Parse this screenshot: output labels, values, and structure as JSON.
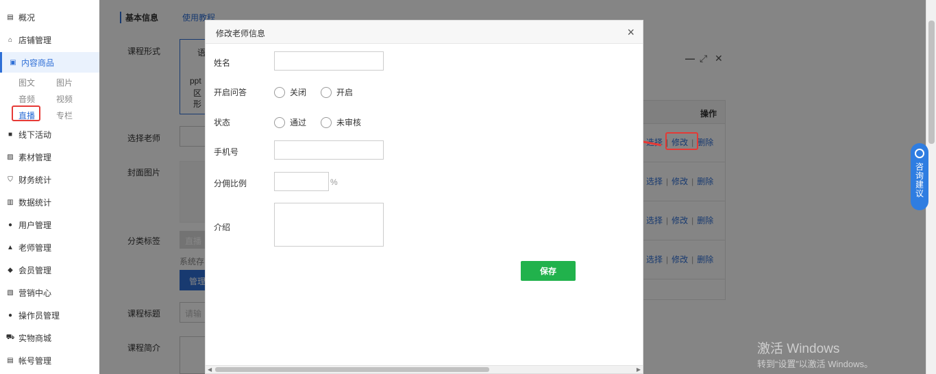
{
  "sidebar": {
    "items": [
      {
        "label": "概况",
        "icon": "dashboard-icon"
      },
      {
        "label": "店铺管理",
        "icon": "store-icon"
      },
      {
        "label": "内容商品",
        "icon": "bag-icon"
      },
      {
        "label": "线下活动",
        "icon": "flag-icon"
      },
      {
        "label": "素材管理",
        "icon": "image-icon"
      },
      {
        "label": "财务统计",
        "icon": "shield-icon"
      },
      {
        "label": "数据统计",
        "icon": "bar-chart-icon"
      },
      {
        "label": "用户管理",
        "icon": "user-icon"
      },
      {
        "label": "老师管理",
        "icon": "graduation-cap-icon"
      },
      {
        "label": "会员管理",
        "icon": "diamond-icon"
      },
      {
        "label": "营销中心",
        "icon": "trend-icon"
      },
      {
        "label": "操作员管理",
        "icon": "operator-icon"
      },
      {
        "label": "实物商城",
        "icon": "cart-icon"
      },
      {
        "label": "帐号管理",
        "icon": "id-card-icon"
      }
    ],
    "sub_items": [
      "图文",
      "图片",
      "音频",
      "视频",
      "直播",
      "专栏"
    ]
  },
  "background_page": {
    "section_title": "基本信息",
    "tutorial_link": "使用教程",
    "labels": [
      "课程形式",
      "选择老师",
      "封面图片",
      "分类标签",
      "课程标题",
      "课程简介"
    ],
    "fragments": {
      "format_a": "语",
      "format_b": "ppt",
      "format_c": "区",
      "format_d": "形",
      "tag_btn": "直播",
      "tag_hint": "系统存",
      "manage_btn": "管理",
      "title_placeholder": "请输"
    }
  },
  "list_dialog": {
    "column_header": "操作",
    "rows": [
      {
        "select": "选择",
        "edit": "修改",
        "delete": "删除"
      },
      {
        "select": "选择",
        "edit": "修改",
        "delete": "删除"
      },
      {
        "select": "选择",
        "edit": "修改",
        "delete": "删除"
      },
      {
        "select": "选择",
        "edit": "修改",
        "delete": "删除"
      }
    ]
  },
  "modal": {
    "title": "修改老师信息",
    "close": "×",
    "fields": {
      "name_label": "姓名",
      "qa_label": "开启问答",
      "qa_options": [
        "关闭",
        "开启"
      ],
      "status_label": "状态",
      "status_options": [
        "通过",
        "未审核"
      ],
      "phone_label": "手机号",
      "commission_label": "分佣比例",
      "commission_unit": "%",
      "intro_label": "介绍"
    },
    "save_button": "保存"
  },
  "consult_button": "咨询建议",
  "watermark": {
    "line1": "激活 Windows",
    "line2": "转到“设置”以激活 Windows。"
  },
  "colors": {
    "accent": "#2f6fd6",
    "save": "#21b24c",
    "annotation": "#e53935",
    "consult": "#2f7de1"
  }
}
